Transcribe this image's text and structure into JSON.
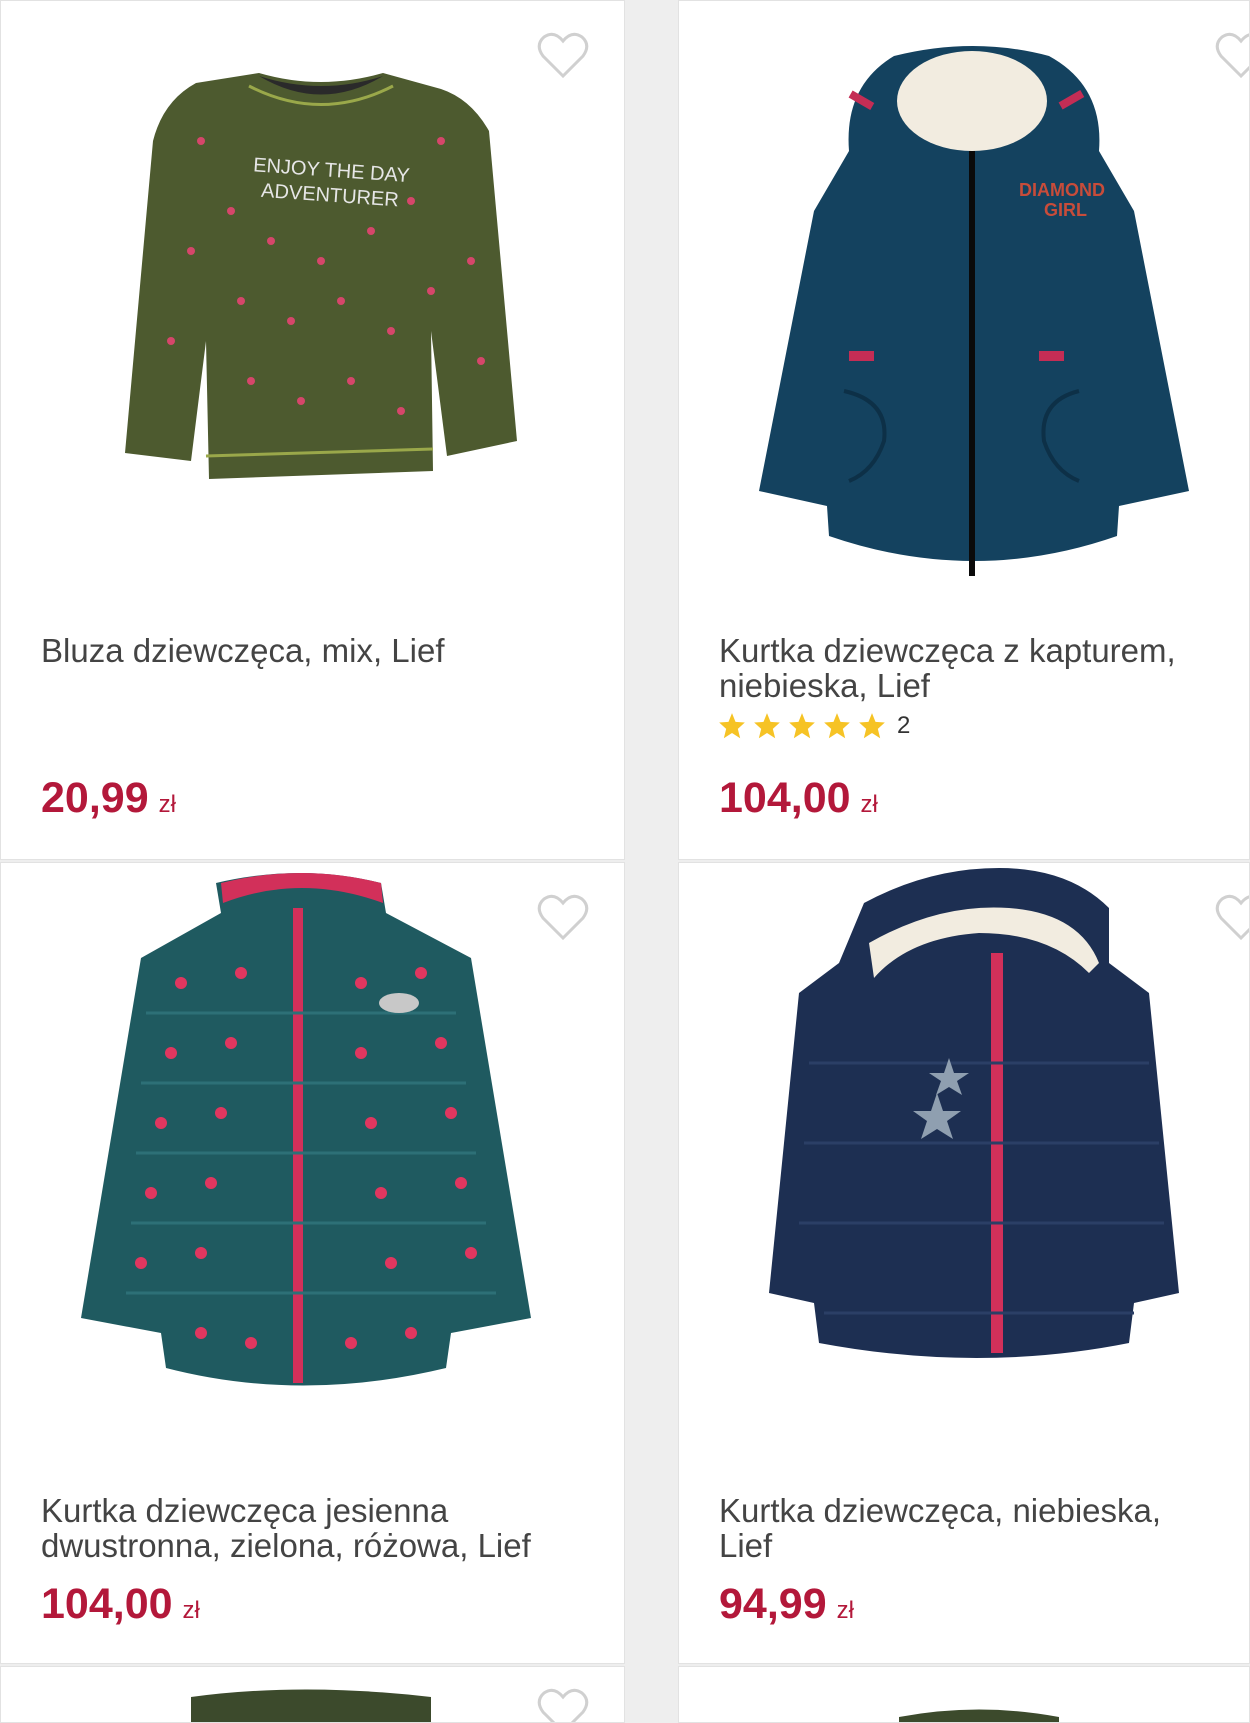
{
  "products": [
    {
      "title": "Bluza dziewczęca, mix, Lief",
      "price": "20,99",
      "currency": "zł",
      "image": "green-sweatshirt"
    },
    {
      "title": "Kurtka dziewczęca z kapturem, niebieska, Lief",
      "price": "104,00",
      "currency": "zł",
      "image": "navy-parka",
      "rating": 5,
      "review_count": "2"
    },
    {
      "title": "Kurtka dziewczęca jesienna dwustronna, zielona, różowa, Lief",
      "price": "104,00",
      "currency": "zł",
      "image": "teal-dotted-puffer"
    },
    {
      "title": "Kurtka dziewczęca, niebieska, Lief",
      "price": "94,99",
      "currency": "zł",
      "image": "navy-hooded-puffer"
    }
  ],
  "colors": {
    "price": "#b3183a",
    "star": "#f6c325",
    "heart": "#d0d0d0"
  },
  "icons": {
    "wishlist": "heart-outline-icon",
    "rating": "star-icon"
  }
}
